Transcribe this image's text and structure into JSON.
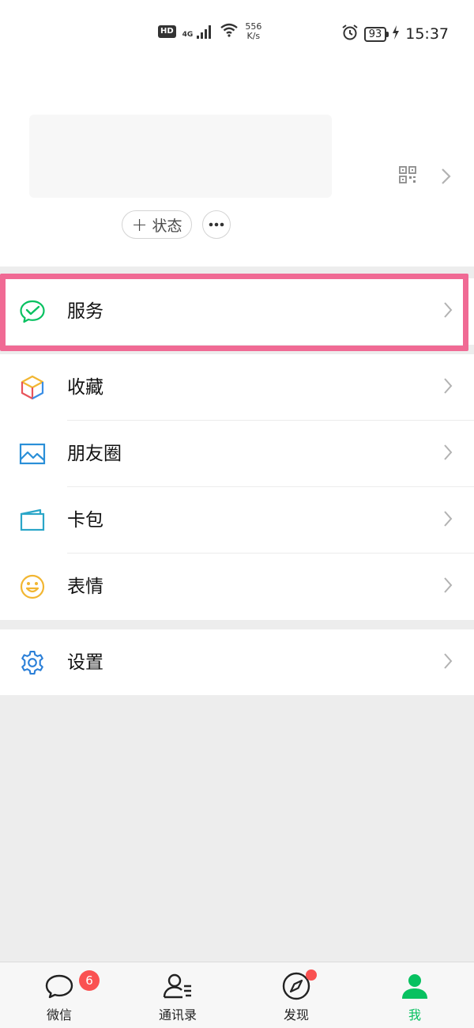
{
  "status_bar": {
    "hd": "HD",
    "network": "4G",
    "speed_value": "556",
    "speed_unit": "K/s",
    "battery": "93",
    "time": "15:37"
  },
  "profile": {
    "status_button_label": "状态"
  },
  "menu": {
    "items": [
      {
        "label": "服务",
        "icon": "wechat-pay-icon"
      },
      {
        "label": "收藏",
        "icon": "favorites-cube-icon"
      },
      {
        "label": "朋友圈",
        "icon": "moments-picture-icon"
      },
      {
        "label": "卡包",
        "icon": "card-wallet-icon"
      },
      {
        "label": "表情",
        "icon": "sticker-smile-icon"
      },
      {
        "label": "设置",
        "icon": "settings-gear-icon"
      }
    ]
  },
  "tabbar": {
    "tabs": [
      {
        "label": "微信",
        "icon": "chat-bubble-icon"
      },
      {
        "label": "通讯录",
        "icon": "contacts-icon"
      },
      {
        "label": "发现",
        "icon": "compass-icon"
      },
      {
        "label": "我",
        "icon": "person-icon"
      }
    ],
    "chat_badge": "6",
    "active_tab": "我"
  },
  "colors": {
    "accent_green": "#07c160",
    "badge_red": "#fa5151",
    "highlight_pink": "#f06a94"
  }
}
